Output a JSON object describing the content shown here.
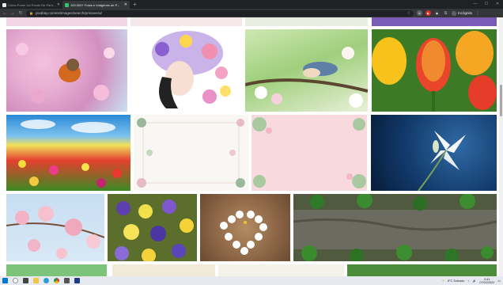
{
  "browser": {
    "tabs": [
      {
        "title": "Como Poner Un Fondo De Pant...",
        "active": false,
        "favicon_color": "#e8eaed"
      },
      {
        "title": "100.000+ Fotos e Imágenes de P...",
        "active": true,
        "favicon_color": "#2ec66d"
      }
    ],
    "new_tab_icon": "plus-icon",
    "address": {
      "url": "pixabay.com/es/images/search/primavera/",
      "lock_icon": "lock-icon"
    },
    "profile_label": "Incógnito"
  },
  "images": [
    {
      "name": "robin-bird-blossoms"
    },
    {
      "name": "girl-flower-crown"
    },
    {
      "name": "nuthatch-bird-branch"
    },
    {
      "name": "tulips-orange-yellow"
    },
    {
      "name": "tulip-field"
    },
    {
      "name": "floral-frame-white"
    },
    {
      "name": "floral-frame-pink"
    },
    {
      "name": "white-lily-blue"
    },
    {
      "name": "cherry-blossom-sky"
    },
    {
      "name": "pansies-flowers"
    },
    {
      "name": "daisy-heart-wood"
    },
    {
      "name": "ivy-tree-bark"
    }
  ],
  "taskbar": {
    "weather": "8°C  Soleado",
    "time": "0:41",
    "date": "07/02/2022",
    "accent": "#1a73e8"
  }
}
